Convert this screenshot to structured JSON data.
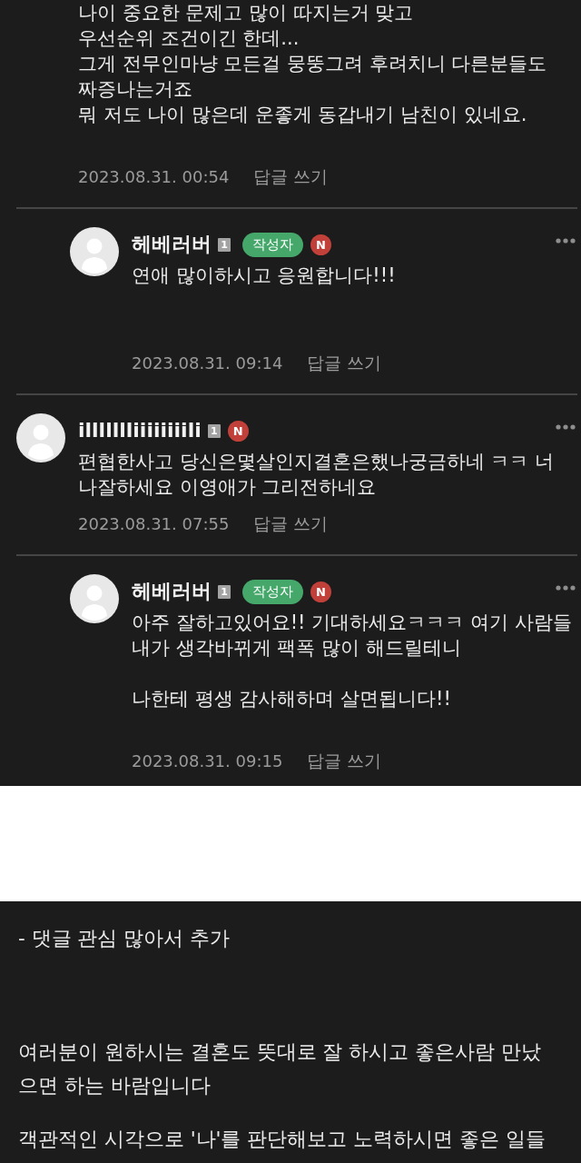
{
  "comments": [
    {
      "kind": "comment",
      "text": "나이 중요한 문제고 많이 따지는거 맞고\n우선순위 조건이긴 한데...\n그게 전무인마냥 모든걸 뭉뚱그려 후려치니 다른분들도\n짜증나는거죠\n뭐 저도 나이 많은데 운좋게 동갑내기 남친이 있네요.\n\n",
      "date": "2023.08.31. 00:54",
      "reply_label": "답글 쓰기"
    },
    {
      "kind": "reply",
      "author": "헤베러버",
      "level": "1",
      "author_badge": "작성자",
      "new_badge": "N",
      "text": "연애 많이하시고 응원합니다!!!\n\n\n",
      "date": "2023.08.31. 09:14",
      "reply_label": "답글 쓰기"
    },
    {
      "kind": "comment",
      "author": "illllllliiiiiiiili",
      "level": "1",
      "new_badge": "N",
      "text": "편협한사고 당신은몇살인지결혼은했나궁금하네 ㅋㅋ 너\n나잘하세요 이영애가 그리전하네요",
      "date": "2023.08.31. 07:55",
      "reply_label": "답글 쓰기"
    },
    {
      "kind": "reply",
      "author": "헤베러버",
      "level": "1",
      "author_badge": "작성자",
      "new_badge": "N",
      "text": "아주 잘하고있어요!! 기대하세요ㅋㅋㅋ 여기 사람들\n내가 생각바뀌게 팩폭 많이 해드릴테니\n\n나한테 평생 감사해하며 살면됩니다!!\n\n",
      "date": "2023.08.31. 09:15",
      "reply_label": "답글 쓰기"
    }
  ],
  "post": {
    "paragraphs": [
      "- 댓글 관심 많아서 추가",
      "여러분이 원하시는 결혼도 뜻대로 잘 하시고 좋은사람 만났\n으면 하는 바람입니다",
      "객관적인 시각으로 '나'를 판단해보고 노력하시면 좋은 일들"
    ]
  }
}
